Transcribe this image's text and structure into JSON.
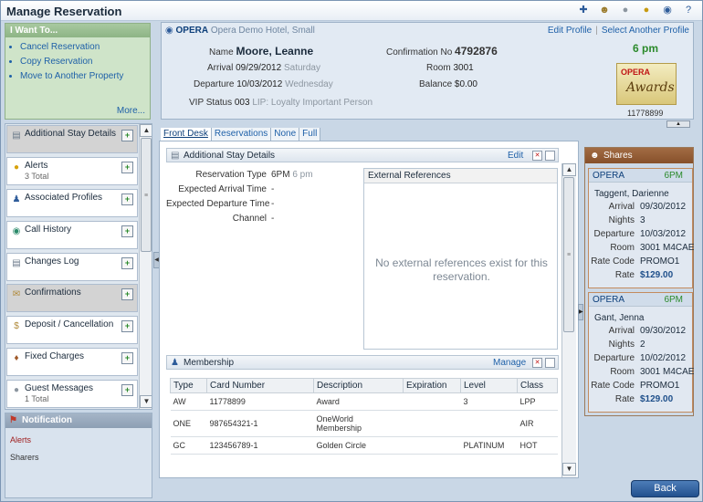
{
  "window": {
    "title": "Manage Reservation"
  },
  "toolbar_icons": [
    "puzzle-icon",
    "people-icon",
    "chat-icon",
    "info-icon",
    "globe-icon",
    "help-icon"
  ],
  "iwant": {
    "title": "I Want To...",
    "items": [
      "Cancel Reservation",
      "Copy Reservation",
      "Move to Another Property"
    ],
    "more": "More..."
  },
  "left_items": [
    {
      "label": "Additional Stay Details",
      "sub": "",
      "icon": "document-icon"
    },
    {
      "label": "Alerts",
      "sub": "3 Total",
      "icon": "alert-icon"
    },
    {
      "label": "Associated Profiles",
      "sub": "",
      "icon": "person-icon"
    },
    {
      "label": "Call History",
      "sub": "",
      "icon": "globe-icon"
    },
    {
      "label": "Changes Log",
      "sub": "",
      "icon": "document-icon"
    },
    {
      "label": "Confirmations",
      "sub": "",
      "icon": "envelope-icon"
    },
    {
      "label": "Deposit / Cancellation",
      "sub": "",
      "icon": "money-icon"
    },
    {
      "label": "Fixed Charges",
      "sub": "",
      "icon": "charges-icon"
    },
    {
      "label": "Guest Messages",
      "sub": "1 Total",
      "icon": "message-icon"
    }
  ],
  "notification": {
    "title": "Notification",
    "items": [
      "Alerts",
      "Sharers"
    ]
  },
  "profile": {
    "brand": "OPERA",
    "hotel": "Opera Demo Hotel, Small",
    "edit_profile": "Edit Profile",
    "select_profile": "Select Another Profile",
    "name_label": "Name",
    "name": "Moore, Leanne",
    "arrival_label": "Arrival",
    "arrival": "09/29/2012",
    "arrival_day": "Saturday",
    "departure_label": "Departure",
    "departure": "10/03/2012",
    "departure_day": "Wednesday",
    "vip_label": "VIP Status",
    "vip": "003",
    "vip_desc": "LIP: Loyalty Important Person",
    "conf_label": "Confirmation No",
    "conf": "4792876",
    "room_label": "Room",
    "room": "3001",
    "balance_label": "Balance",
    "balance": "$0.00",
    "time": "6 pm",
    "award_brand": "OPERA",
    "award_text": "Awards",
    "profile_no": "11778899"
  },
  "view_tabs": [
    "Front Desk",
    "Reservations",
    "None",
    "Full"
  ],
  "stay_details": {
    "title": "Additional Stay Details",
    "edit": "Edit",
    "fields": [
      {
        "label": "Reservation Type",
        "value": "6PM",
        "extra": "6 pm"
      },
      {
        "label": "Expected Arrival Time",
        "value": "-",
        "extra": ""
      },
      {
        "label": "Expected Departure Time",
        "value": "-",
        "extra": ""
      },
      {
        "label": "Channel",
        "value": "-",
        "extra": ""
      }
    ],
    "ext_title": "External References",
    "ext_message": "No external references exist for this reservation."
  },
  "membership": {
    "title": "Membership",
    "manage": "Manage",
    "columns": [
      "Type",
      "Card Number",
      "Description",
      "Expiration",
      "Level",
      "Class"
    ],
    "rows": [
      [
        "AW",
        "11778899",
        "Award",
        "",
        "3",
        "LPP"
      ],
      [
        "ONE",
        "987654321-1",
        "OneWorld Membership",
        "",
        "",
        "AIR"
      ],
      [
        "GC",
        "123456789-1",
        "Golden Circle",
        "",
        "PLATINUM",
        "HOT"
      ]
    ]
  },
  "shares": {
    "title": "Shares",
    "cards": [
      {
        "brand": "OPERA",
        "time": "6PM",
        "name": "Taggent, Darienne",
        "arrival": "09/30/2012",
        "nights": "3",
        "departure": "10/03/2012",
        "room": "3001 M4CAE",
        "rate_code": "PROMO1",
        "rate": "$129.00"
      },
      {
        "brand": "OPERA",
        "time": "6PM",
        "name": "Gant, Jenna",
        "arrival": "09/30/2012",
        "nights": "2",
        "departure": "10/02/2012",
        "room": "3001 M4CAE",
        "rate_code": "PROMO1",
        "rate": "$129.00"
      }
    ],
    "labels": {
      "arrival": "Arrival",
      "nights": "Nights",
      "departure": "Departure",
      "room": "Room",
      "rate_code": "Rate Code",
      "rate": "Rate"
    }
  },
  "back_label": "Back"
}
